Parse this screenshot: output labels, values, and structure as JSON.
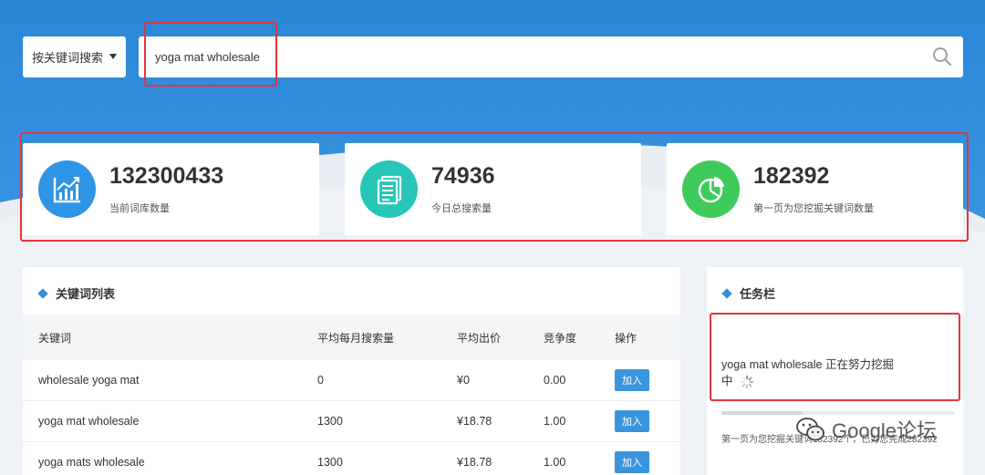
{
  "search": {
    "mode_label": "按关键词搜索",
    "query": "yoga mat wholesale"
  },
  "stats": [
    {
      "value": "132300433",
      "label": "当前词库数量",
      "icon": "trend-chart-icon",
      "color": "#2f95e6"
    },
    {
      "value": "74936",
      "label": "今日总搜索量",
      "icon": "document-icon",
      "color": "#27c6b8"
    },
    {
      "value": "182392",
      "label": "第一页为您挖掘关键词数量",
      "icon": "pie-chart-icon",
      "color": "#3fcb5b"
    }
  ],
  "keywords_panel": {
    "title": "关键词列表",
    "columns": [
      "关键词",
      "平均每月搜索量",
      "平均出价",
      "竞争度",
      "操作"
    ],
    "rows": [
      {
        "keyword": "wholesale yoga mat",
        "volume": "0",
        "bid": "¥0",
        "competition": "0.00",
        "action": "加入"
      },
      {
        "keyword": "yoga mat wholesale",
        "volume": "1300",
        "bid": "¥18.78",
        "competition": "1.00",
        "action": "加入"
      },
      {
        "keyword": "yoga mats wholesale",
        "volume": "1300",
        "bid": "¥18.78",
        "competition": "1.00",
        "action": "加入"
      }
    ]
  },
  "task_panel": {
    "title": "任务栏",
    "task_line1": "yoga mat wholesale 正在努力挖掘",
    "task_line2": "中",
    "progress_text": "第一页为您挖掘关键词182392个，已为您完成282392",
    "progress": 0.35
  },
  "watermark": "Google论坛",
  "colors": {
    "accent": "#2f8fe0",
    "highlight": "#e3343f"
  }
}
